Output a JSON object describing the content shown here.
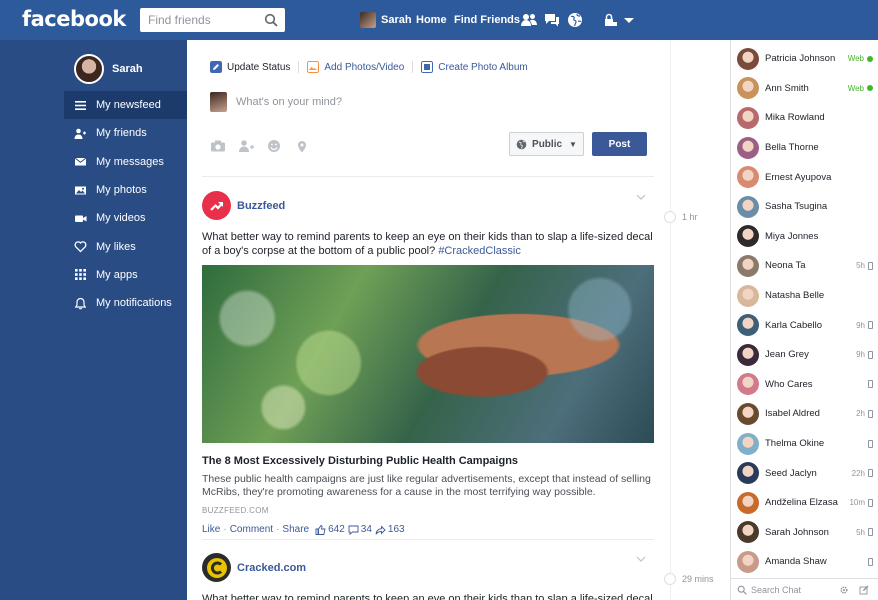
{
  "app": {
    "logo": "facebook"
  },
  "topbar": {
    "search_placeholder": "Find friends",
    "user_name": "Sarah",
    "home_label": "Home",
    "find_friends_label": "Find Friends"
  },
  "sidebar": {
    "profile_name": "Sarah",
    "items": [
      {
        "label": "My newsfeed",
        "icon": "menu-icon",
        "active": true
      },
      {
        "label": "My friends",
        "icon": "friends-icon"
      },
      {
        "label": "My messages",
        "icon": "envelope-icon"
      },
      {
        "label": "My photos",
        "icon": "photo-icon"
      },
      {
        "label": "My videos",
        "icon": "video-icon"
      },
      {
        "label": "My likes",
        "icon": "heart-icon"
      },
      {
        "label": "My apps",
        "icon": "apps-grid-icon"
      },
      {
        "label": "My notifications",
        "icon": "bell-icon"
      }
    ]
  },
  "composer": {
    "tabs": [
      "Update Status",
      "Add Photos/Video",
      "Create Photo Album"
    ],
    "placeholder": "What's on your mind?",
    "privacy_label": "Public",
    "post_label": "Post"
  },
  "posts": [
    {
      "author": "Buzzfeed",
      "time": "1 hr",
      "text": "What better way to remind parents to keep an eye on their kids than to slap a life-sized decal of a boy's corpse at the bottom of a public pool? ",
      "hashtag": "#CrackedClassic",
      "link_title": "The 8 Most Excessively Disturbing Public Health Campaigns",
      "link_desc": "These public health campaigns are just like regular advertisements, except that instead of selling McRibs, they're promoting awareness for a cause in the most terrifying way possible.",
      "domain": "BUZZFEED.COM",
      "like": "Like",
      "comment": "Comment",
      "share": "Share",
      "likes_count": "642",
      "comments_count": "34",
      "shares_count": "163"
    },
    {
      "author": "Cracked.com",
      "time": "29 mins",
      "text": "What better way to remind parents to keep an eye on their kids than to slap a life-sized decal of"
    }
  ],
  "chat": {
    "search_placeholder": "Search Chat",
    "contacts": [
      {
        "name": "Patricia Johnson",
        "status": "Web",
        "type": "web",
        "color": "#7a4b3a"
      },
      {
        "name": "Ann Smith",
        "status": "Web",
        "type": "web",
        "color": "#c8935a"
      },
      {
        "name": "Mika Rowland",
        "status": "",
        "type": "none",
        "color": "#b86a6a"
      },
      {
        "name": "Bella Thorne",
        "status": "",
        "type": "none",
        "color": "#9b5f86"
      },
      {
        "name": "Ernest Ayupova",
        "status": "",
        "type": "none",
        "color": "#d88b6f"
      },
      {
        "name": "Sasha Tsugina",
        "status": "",
        "type": "none",
        "color": "#6a8ea8"
      },
      {
        "name": "Miya Jonnes",
        "status": "",
        "type": "none",
        "color": "#2f2a2a"
      },
      {
        "name": "Neona Ta",
        "status": "5h",
        "type": "mobile",
        "color": "#8a7a6a"
      },
      {
        "name": "Natasha Belle",
        "status": "",
        "type": "none",
        "color": "#d8b89a"
      },
      {
        "name": "Karla Cabello",
        "status": "9h",
        "type": "mobile",
        "color": "#3e5f78"
      },
      {
        "name": "Jean Grey",
        "status": "9h",
        "type": "mobile",
        "color": "#3a2a3a"
      },
      {
        "name": "Who Cares",
        "status": "",
        "type": "mobile",
        "color": "#d07a8a"
      },
      {
        "name": "Isabel Aldred",
        "status": "2h",
        "type": "mobile",
        "color": "#6a4a2e"
      },
      {
        "name": "Thelma Okine",
        "status": "",
        "type": "mobile",
        "color": "#7fb0c8"
      },
      {
        "name": "Seed Jaclyn",
        "status": "22h",
        "type": "mobile",
        "color": "#2a3a5a"
      },
      {
        "name": "Andželina Elzasa",
        "status": "10m",
        "type": "mobile",
        "color": "#c86a2a"
      },
      {
        "name": "Sarah Johnson",
        "status": "5h",
        "type": "mobile",
        "color": "#4a3a2a"
      },
      {
        "name": "Amanda Shaw",
        "status": "",
        "type": "mobile",
        "color": "#c89a8a"
      }
    ]
  }
}
